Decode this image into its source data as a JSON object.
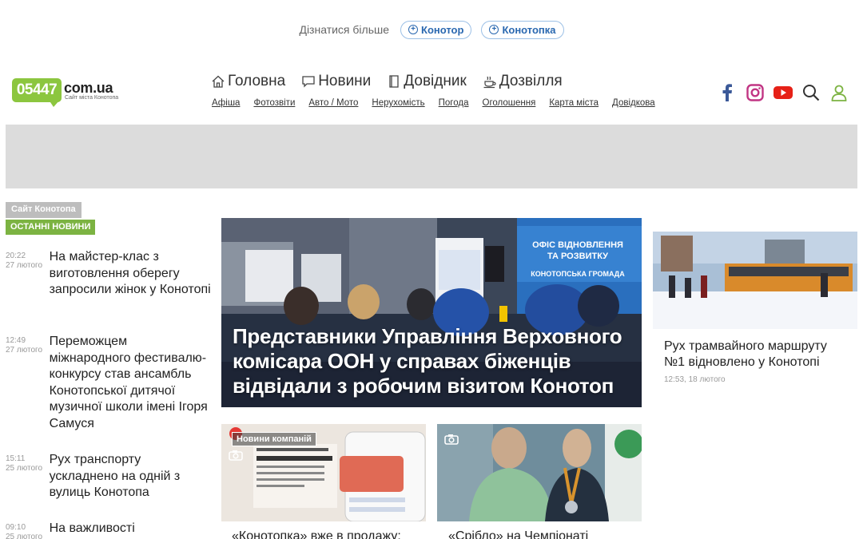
{
  "topbar": {
    "learn_more": "Дізнатися більше",
    "pills": [
      "Конотор",
      "Конотопка"
    ]
  },
  "logo": {
    "number": "05447",
    "domain": "com.ua",
    "subtitle": "Сайт міста Конотопа"
  },
  "nav": {
    "main": [
      {
        "label": "Головна",
        "icon": "home-icon"
      },
      {
        "label": "Новини",
        "icon": "chat-icon"
      },
      {
        "label": "Довідник",
        "icon": "book-icon"
      },
      {
        "label": "Дозвілля",
        "icon": "coffee-icon"
      }
    ],
    "sub": [
      "Афіша",
      "Фотозвіти",
      "Авто / Мото",
      "Нерухомість",
      "Погода",
      "Оголошення",
      "Карта міста",
      "Довідкова"
    ]
  },
  "social": [
    "facebook-icon",
    "instagram-icon",
    "youtube-icon",
    "search-icon",
    "user-icon"
  ],
  "colors": {
    "brand_green": "#8cc63f",
    "latest_green": "#7cb342",
    "link_blue": "#2a68b0",
    "facebook": "#3b5998",
    "instagram": "#c13584",
    "youtube": "#e62117"
  },
  "sidebar": {
    "site_tag": "Сайт Конотопа",
    "latest_tag": "ОСТАННІ НОВИНИ",
    "news": [
      {
        "time": "20:22",
        "date": "27 лютого",
        "title": "На майстер-клас з виготовлення оберегу запросили жінок у Конотопі"
      },
      {
        "time": "12:49",
        "date": "27 лютого",
        "title": "Переможцем міжнародного фестивалю-конкурсу став ансамбль Конотопської дитячої музичної школи імені Ігоря Самуся"
      },
      {
        "time": "15:11",
        "date": "25 лютого",
        "title": "Рух транспорту ускладнено на одній з вулиць Конотопа"
      },
      {
        "time": "09:10",
        "date": "25 лютого",
        "title": "На важливості"
      }
    ]
  },
  "hero": {
    "title": "Представники Управління Верховного комісара ООН у справах біженців відвідали з робочим візитом Конотоп",
    "sign_lines": [
      "ОФІС ВІДНОВЛЕННЯ",
      "ТА РОЗВИТКУ",
      "КОНОТОПСЬКА ГРОМАДА"
    ]
  },
  "right_card": {
    "title": "Рух трамвайного маршруту №1 відновлено у Конотопі",
    "time": "12:53, 18 лютого"
  },
  "bottom_cards": [
    {
      "badge": "Новини компаній",
      "title": "«Конотопка» вже в продажу:"
    },
    {
      "title": "«Срібло» на Чемпіонаті"
    }
  ]
}
